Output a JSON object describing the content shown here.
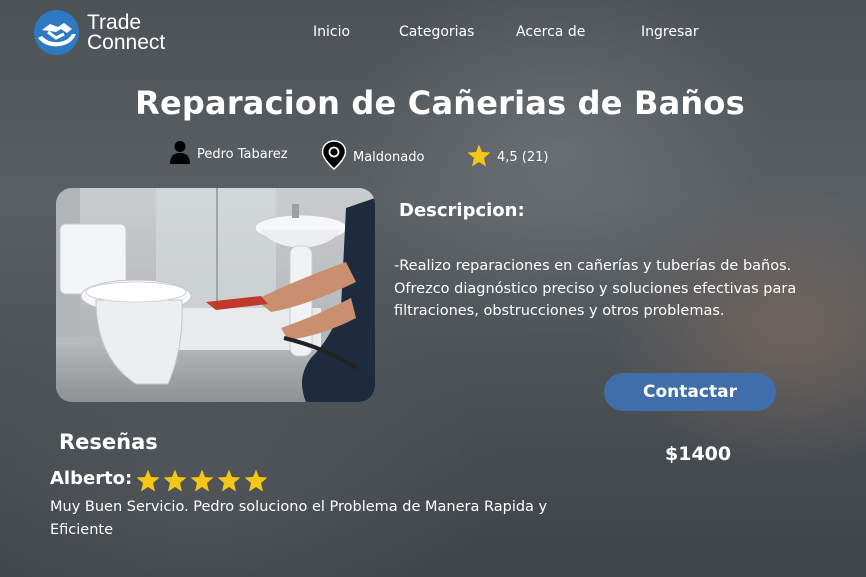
{
  "brand": {
    "line1": "Trade",
    "line2": "Connect",
    "color": "#2f79c2"
  },
  "nav": {
    "inicio": "Inicio",
    "categorias": "Categorias",
    "acerca": "Acerca de",
    "ingresar": "Ingresar"
  },
  "listing": {
    "title": "Reparacion de Cañerias de Baños",
    "provider": "Pedro Tabarez",
    "location": "Maldonado",
    "rating": "4,5 (21)",
    "description_label": "Descripcion:",
    "description": "-Realizo reparaciones en cañerías y tuberías de baños.\n Ofrezco diagnóstico preciso y soluciones efectivas para filtraciones, obstrucciones y otros problemas.",
    "contact_label": "Contactar",
    "price": "$1400"
  },
  "reviews": {
    "heading": "Reseñas",
    "items": [
      {
        "author": "Alberto:",
        "stars": 5,
        "text": "Muy Buen Servicio. Pedro soluciono el Problema de Manera Rapida y Eficiente"
      }
    ]
  },
  "icons": {
    "provider": "person-icon",
    "location": "map-pin-icon",
    "rating": "star-icon"
  },
  "colors": {
    "accent_button": "#3f6ea8",
    "star": "#f5c518"
  }
}
